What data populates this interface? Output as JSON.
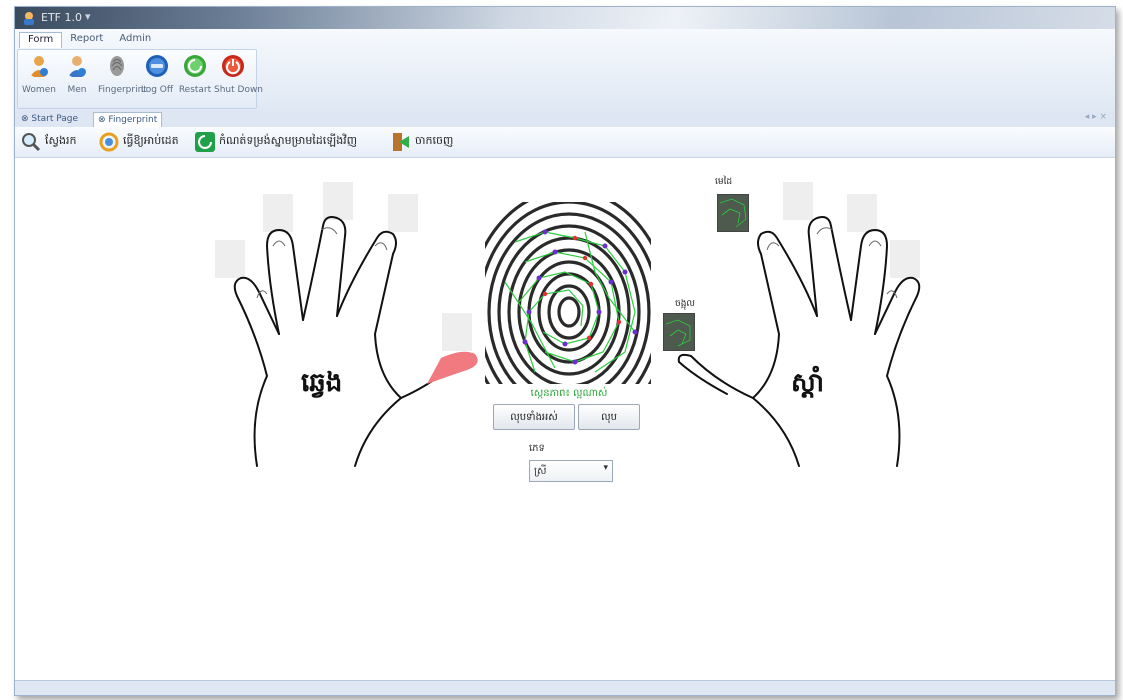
{
  "window": {
    "title": "ETF 1.0"
  },
  "ribbon": {
    "tabs": [
      {
        "label": "Form",
        "active": true
      },
      {
        "label": "Report",
        "active": false
      },
      {
        "label": "Admin",
        "active": false
      }
    ],
    "buttons": [
      {
        "label": "Women",
        "icon": "women-user-icon"
      },
      {
        "label": "Men",
        "icon": "men-user-icon"
      },
      {
        "label": "Fingerprint",
        "icon": "fingerprint-icon"
      },
      {
        "label": "Log Off",
        "icon": "log-off-icon"
      },
      {
        "label": "Restart",
        "icon": "restart-icon"
      },
      {
        "label": "Shut Down",
        "icon": "shut-down-icon"
      }
    ]
  },
  "doc_tabs": [
    {
      "label": "Start Page",
      "active": false
    },
    {
      "label": "Fingerprint",
      "active": true
    }
  ],
  "toolbar": {
    "items": [
      {
        "label": "ស្វែងរក",
        "icon": "search-icon"
      },
      {
        "label": "ធ្វើឱ្យអាប់ដេត",
        "icon": "refresh-icon"
      },
      {
        "label": "កំណត់ទម្រង់ស្នាមម្រាមដៃឡើងវិញ",
        "icon": "reset-icon"
      },
      {
        "label": "ចាកចេញ",
        "icon": "exit-door-icon"
      }
    ]
  },
  "main": {
    "left_hand_label": "ឆ្វេង",
    "right_hand_label": "ស្តាំ",
    "fingerprint_caption": "ស្កេនភាព៖ ល្អណាស់",
    "btn_delete_all": "លុបទាំងអស់",
    "btn_delete": "លុប",
    "gender_label": "ភេទ",
    "gender_value": "ស្រី",
    "thumb_index_label": "មេដៃ",
    "thumb_middle_label": "ចង្អុល"
  },
  "colors": {
    "accent": "#3b5a86",
    "ribbon_bg": "#dfe8f4",
    "selected_finger": "#e8424a",
    "fingerprint_lines": "#2ecc40",
    "caption_green": "#2aa63a"
  }
}
